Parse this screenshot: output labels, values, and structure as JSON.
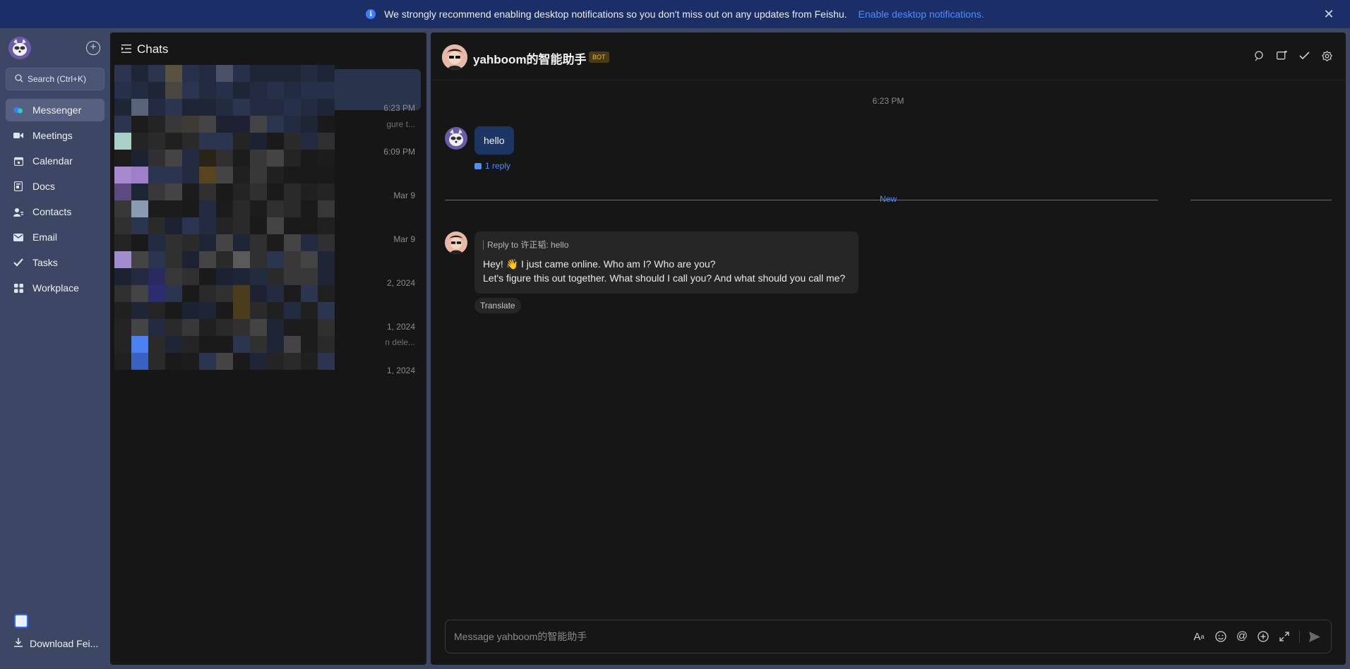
{
  "banner": {
    "message": "We strongly recommend enabling desktop notifications so you don't miss out on any updates from Feishu.",
    "link": "Enable desktop notifications.",
    "info_glyph": "i",
    "close_glyph": "✕"
  },
  "nav": {
    "search_label": "Search (Ctrl+K)",
    "items": [
      {
        "label": "Messenger",
        "icon": "messenger-icon"
      },
      {
        "label": "Meetings",
        "icon": "video-icon"
      },
      {
        "label": "Calendar",
        "icon": "calendar-icon"
      },
      {
        "label": "Docs",
        "icon": "docs-icon"
      },
      {
        "label": "Contacts",
        "icon": "contacts-icon"
      },
      {
        "label": "Email",
        "icon": "mail-icon"
      },
      {
        "label": "Tasks",
        "icon": "check-icon"
      },
      {
        "label": "Workplace",
        "icon": "grid-icon"
      }
    ],
    "download_label": "Download Fei..."
  },
  "chatlist": {
    "title": "Chats",
    "times": [
      "6:23 PM",
      "6:09 PM",
      "Mar 9",
      "Mar 9",
      "2, 2024",
      "1, 2024",
      "1, 2024"
    ],
    "snippets": [
      "gure t...",
      "n dele..."
    ]
  },
  "chat": {
    "title": "yahboom的智能助手",
    "badge": "BOT",
    "timestamp": "6:23 PM",
    "my_message": "hello",
    "reply_count": "1 reply",
    "new_label": "New",
    "bot_quote": "Reply to 许正韬: hello",
    "bot_line1": "Hey! 👋 I just came online. Who am I? Who are you?",
    "bot_line2": "Let's figure this out together. What should I call you? And what should you call me?",
    "translate_label": "Translate",
    "input_placeholder": "Message yahboom的智能助手"
  },
  "colors": {
    "accent": "#4d8dff",
    "banner_bg": "#1b2f66",
    "sidebar_bg": "#3d4763",
    "panel_bg": "#161616",
    "my_bubble": "#1d3563",
    "bot_bubble": "#262626",
    "bot_badge": "#e6b846"
  }
}
